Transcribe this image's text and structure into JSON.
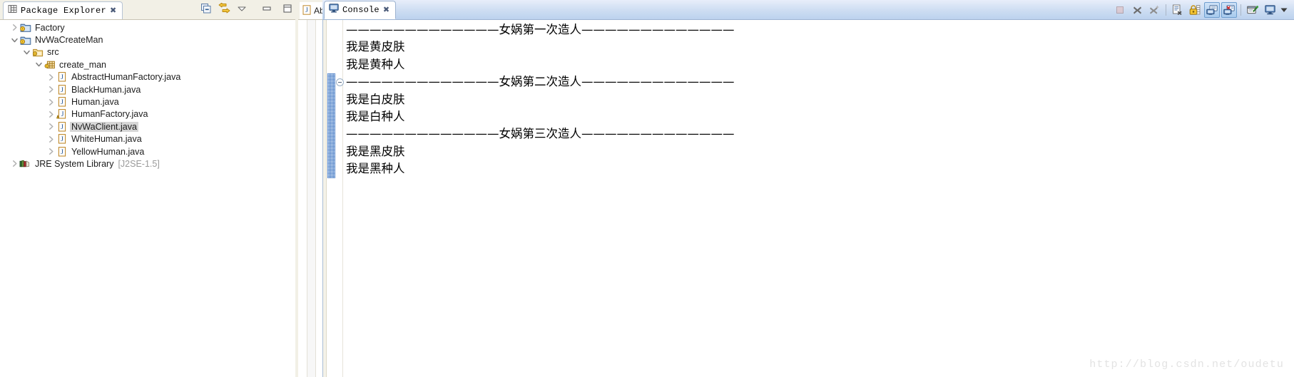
{
  "package_explorer": {
    "tab_label": "Package Explorer",
    "tab_close": "✖",
    "toolbar": {
      "collapse_all": "collapse-all",
      "link_with_editor": "link-with-editor",
      "view_menu": "view-menu",
      "minimize": "minimize",
      "maximize": "maximize"
    },
    "tree": [
      {
        "label": "Factory",
        "sub": "",
        "indent": 0,
        "arrow": "collapsed",
        "icon": "java-project",
        "selected": false
      },
      {
        "label": "NvWaCreateMan",
        "sub": "",
        "indent": 0,
        "arrow": "expanded",
        "icon": "java-project",
        "selected": false
      },
      {
        "label": "src",
        "sub": "",
        "indent": 1,
        "arrow": "expanded",
        "icon": "source-folder",
        "selected": false
      },
      {
        "label": "create_man",
        "sub": "",
        "indent": 2,
        "arrow": "expanded",
        "icon": "package",
        "selected": false
      },
      {
        "label": "AbstractHumanFactory.java",
        "sub": "",
        "indent": 3,
        "arrow": "collapsed",
        "icon": "java-file",
        "selected": false
      },
      {
        "label": "BlackHuman.java",
        "sub": "",
        "indent": 3,
        "arrow": "collapsed",
        "icon": "java-file",
        "selected": false
      },
      {
        "label": "Human.java",
        "sub": "",
        "indent": 3,
        "arrow": "collapsed",
        "icon": "java-file",
        "selected": false
      },
      {
        "label": "HumanFactory.java",
        "sub": "",
        "indent": 3,
        "arrow": "collapsed",
        "icon": "java-file-warning",
        "selected": false
      },
      {
        "label": "NvWaClient.java",
        "sub": "",
        "indent": 3,
        "arrow": "collapsed",
        "icon": "java-file",
        "selected": true
      },
      {
        "label": "WhiteHuman.java",
        "sub": "",
        "indent": 3,
        "arrow": "collapsed",
        "icon": "java-file",
        "selected": false
      },
      {
        "label": "YellowHuman.java",
        "sub": "",
        "indent": 3,
        "arrow": "collapsed",
        "icon": "java-file",
        "selected": false
      },
      {
        "label": "JRE System Library",
        "sub": "[J2SE-1.5]",
        "indent": 0,
        "arrow": "collapsed",
        "icon": "jre-library",
        "selected": false
      }
    ]
  },
  "editor_stub": {
    "tab_label": "Ab",
    "tab_icon": "java-file-icon"
  },
  "console": {
    "tab_label": "Console",
    "tab_close": "✖",
    "toolbar_buttons": [
      {
        "name": "terminate-button",
        "icon": "stop-square",
        "state": "disabled"
      },
      {
        "name": "remove-launch-button",
        "icon": "cross-gray",
        "state": "normal"
      },
      {
        "name": "remove-all-terminated-button",
        "icon": "cross-sparkle",
        "state": "normal"
      },
      {
        "name": "separator-1",
        "icon": "separator",
        "state": "none"
      },
      {
        "name": "clear-console-button",
        "icon": "clear-console",
        "state": "normal"
      },
      {
        "name": "scroll-lock-button",
        "icon": "lock",
        "state": "normal"
      },
      {
        "name": "show-console-on-output-button",
        "icon": "console-out",
        "state": "toggled"
      },
      {
        "name": "show-console-on-error-button",
        "icon": "console-err",
        "state": "toggled"
      },
      {
        "name": "separator-2",
        "icon": "separator",
        "state": "none"
      },
      {
        "name": "pin-console-button",
        "icon": "pin-console",
        "state": "normal"
      },
      {
        "name": "open-console-button",
        "icon": "open-console",
        "state": "normal"
      },
      {
        "name": "open-console-dropdown",
        "icon": "chevron-down",
        "state": "normal"
      }
    ],
    "lines": [
      {
        "text": "—————————————女娲第一次造人—————————————",
        "fold": false,
        "changed": false
      },
      {
        "text": "我是黄皮肤",
        "fold": false,
        "changed": false
      },
      {
        "text": "我是黄种人",
        "fold": false,
        "changed": false
      },
      {
        "text": "—————————————女娲第二次造人—————————————",
        "fold": true,
        "changed": true
      },
      {
        "text": "我是白皮肤",
        "fold": false,
        "changed": true
      },
      {
        "text": "我是白种人",
        "fold": false,
        "changed": true
      },
      {
        "text": "—————————————女娲第三次造人—————————————",
        "fold": false,
        "changed": true
      },
      {
        "text": "我是黑皮肤",
        "fold": false,
        "changed": true
      },
      {
        "text": "我是黑种人",
        "fold": false,
        "changed": true
      }
    ]
  },
  "watermark": {
    "text": "http://blog.csdn.net/oudetu"
  },
  "colors": {
    "tab_active_bg": "#ffffff",
    "console_tabbar": "#bcd2ee",
    "selection": "#d6d6d6",
    "muted_text": "#9a9a9a",
    "toolbar_bg": "#f2f0e6",
    "watermark": "#e3e3e3"
  }
}
